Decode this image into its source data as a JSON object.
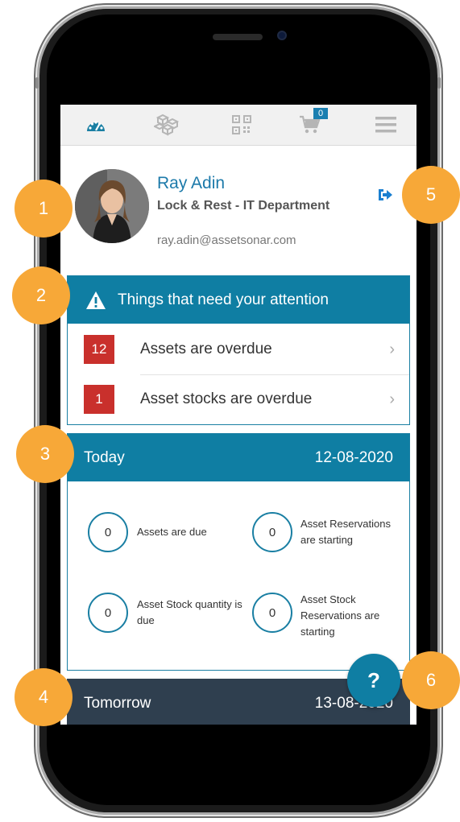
{
  "nav": {
    "items": [
      {
        "name": "dashboard-icon",
        "active": true
      },
      {
        "name": "assets-icon",
        "active": false
      },
      {
        "name": "qr-code-icon",
        "active": false
      },
      {
        "name": "cart-icon",
        "active": false
      },
      {
        "name": "menu-icon",
        "active": false
      }
    ],
    "cart_count": "0"
  },
  "profile": {
    "name": "Ray Adin",
    "department": "Lock & Rest - IT Department",
    "email": "ray.adin@assetsonar.com"
  },
  "attention": {
    "title": "Things that need your attention",
    "items": [
      {
        "count": "12",
        "label": "Assets are overdue"
      },
      {
        "count": "1",
        "label": "Asset stocks are overdue"
      }
    ]
  },
  "today": {
    "label": "Today",
    "date": "12-08-2020",
    "stats": [
      {
        "value": "0",
        "label": "Assets are due"
      },
      {
        "value": "0",
        "label": "Asset Reservations are starting"
      },
      {
        "value": "0",
        "label": "Asset Stock quantity is due"
      },
      {
        "value": "0",
        "label": "Asset Stock Reservations are starting"
      }
    ]
  },
  "tomorrow": {
    "label": "Tomorrow",
    "date": "13-08-2020"
  },
  "help_label": "?",
  "markers": [
    "1",
    "2",
    "3",
    "4",
    "5",
    "6"
  ],
  "colors": {
    "accent": "#0f7ea3",
    "overdue": "#c9302c",
    "marker": "#f7a838",
    "tomorrow_header": "#2f3f4f"
  }
}
